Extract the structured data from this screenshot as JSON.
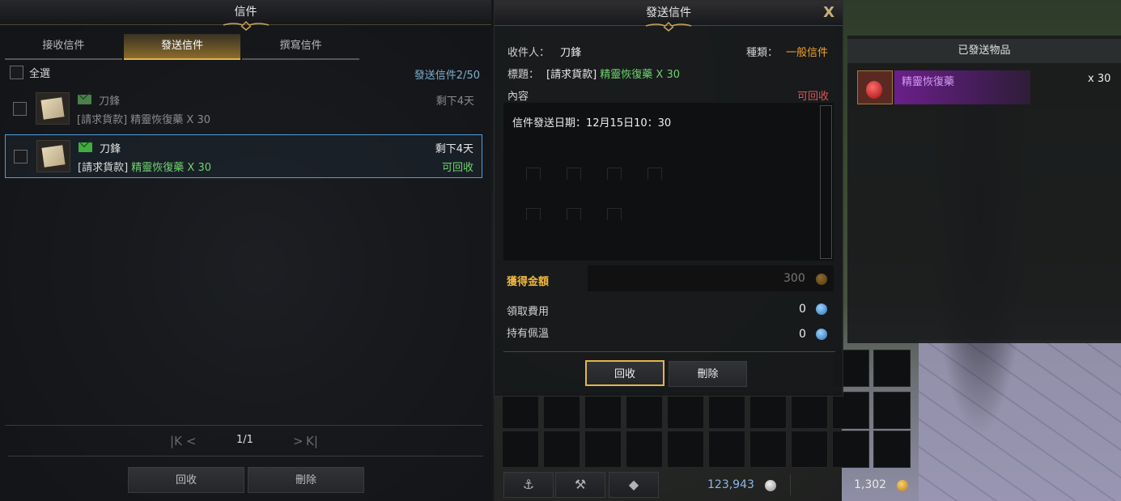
{
  "mail": {
    "title": "信件",
    "tabs": [
      {
        "label": "接收信件",
        "active": false
      },
      {
        "label": "發送信件",
        "active": true
      },
      {
        "label": "撰寫信件",
        "active": false
      }
    ],
    "select_all": "全選",
    "sent_count": "發送信件2/50",
    "rows": [
      {
        "sender": "刀鋒",
        "subject_prefix": "[請求貨款]",
        "subject_item": "精靈恢復藥 X 30",
        "days": "剩下4天",
        "status": ""
      },
      {
        "sender": "刀鋒",
        "subject_prefix": "[請求貨款]",
        "subject_item": "精靈恢復藥 X 30",
        "days": "剩下4天",
        "status": "可回收"
      }
    ],
    "pager": {
      "page": "1/1",
      "first": "K",
      "prev": "<",
      "next": ">",
      "last": "K"
    },
    "buttons": {
      "reclaim": "回收",
      "delete": "刪除"
    }
  },
  "detail": {
    "title": "發送信件",
    "recipient_label": "收件人：",
    "recipient": "刀鋒",
    "type_label": "種類：",
    "type_value": "一般信件",
    "subject_label": "標題：",
    "subject_prefix": "[請求貨款]",
    "subject_item": "精靈恢復藥 X 30",
    "content_label": "內容",
    "reclaimable": "可回收",
    "content_text": "信件發送日期：12月15日10：30",
    "amount_label": "獲得金額",
    "amount_value": "300",
    "fee_label": "領取費用",
    "fee_value": "0",
    "held_label": "持有佩溫",
    "held_value": "0",
    "buttons": {
      "reclaim": "回收",
      "delete": "刪除"
    }
  },
  "sent_items": {
    "title": "已發送物品",
    "items": [
      {
        "name": "精靈恢復藥",
        "qty": "x 30"
      }
    ]
  },
  "inventory": {
    "silver": "123,943",
    "gold": "1,302"
  },
  "colors": {
    "accent_gold": "#e3b64a",
    "green": "#6fd46f",
    "blue_select": "#4f9fd9",
    "orange": "#f2a230"
  }
}
